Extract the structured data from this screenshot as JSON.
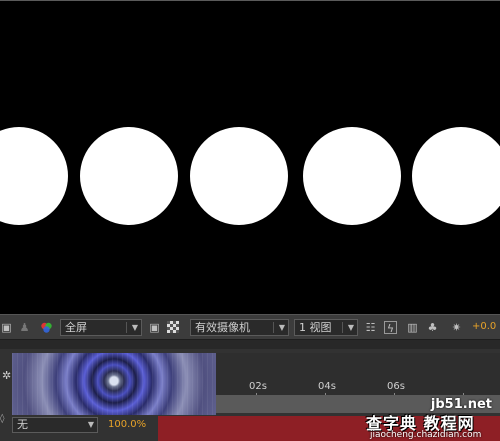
{
  "viewer": {
    "background": "#000000",
    "shape_color": "#ffffff",
    "circle_count": 5
  },
  "toolbar": {
    "resolution": "全屏",
    "camera": "有效摄像机",
    "views": "1 视图",
    "exposure": "+0.0",
    "exposure_color": "#e8a329"
  },
  "timeline": {
    "ticks": [
      "02s",
      "04s",
      "06s"
    ],
    "motion_blur_select": "无",
    "zoom": "100.0%",
    "work_area_color": "#8e1f25"
  },
  "watermark": {
    "site": "jb51.net",
    "main": "查字典 教程网",
    "url": "jiaocheng.chazidian.com"
  }
}
